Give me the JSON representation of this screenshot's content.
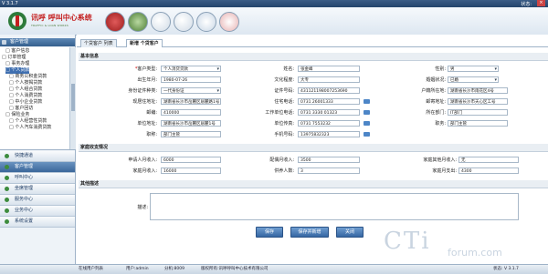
{
  "titlebar": {
    "version": "V 3.1.7",
    "status_label": "状态:",
    "close": "×"
  },
  "header": {
    "brand": "讯呼 呼叫中心系统",
    "brand_en": "TRAFFIC & LOAN WORKS"
  },
  "sidebar": {
    "head1": "客户管理",
    "tree": [
      "□ 客户信息",
      "□ 订单管理",
      "□ 事务办理",
      "□ 个人贷款",
      "□ 商务公积金贷款",
      "□ 个人按揭贷款",
      "□ 个人组合贷款",
      "□ 个人消费贷款",
      "□ 中小企业贷款",
      "□ 客户回访",
      "□ 保险业务",
      "□ 个人经营性贷款",
      "□ 个人汽车消费贷款"
    ],
    "nav": [
      "快捷通道",
      "客户管理",
      "呼叫中心",
      "坐席管理",
      "服务中心",
      "业务中心",
      "系统设置"
    ]
  },
  "tabs": [
    "个贷客户 列表",
    "新增 个贷客户"
  ],
  "section_basic": "基本信息",
  "fields": {
    "customer_type": {
      "label": "客户类型:",
      "value": "个人消贷贷款"
    },
    "name": {
      "label": "姓名:",
      "value": "张金峰"
    },
    "gender": {
      "label": "性别:",
      "value": "男"
    },
    "birthdate": {
      "label": "出生年月:",
      "value": "1980-07-26"
    },
    "education": {
      "label": "文化程度:",
      "value": "大专"
    },
    "marital": {
      "label": "婚姻状况:",
      "value": "已婚"
    },
    "id_type": {
      "label": "身份证件种类:",
      "value": "一代身份证"
    },
    "id_number": {
      "label": "证件号码:",
      "value": "431121198007253690"
    },
    "hukou": {
      "label": "户籍所在地:",
      "value": "湖南省长沙市雨花区4号"
    },
    "address": {
      "label": "现居住地址:",
      "value": "湖南省长沙市岳麓区居麓路1号"
    },
    "home_phone": {
      "label": "住宅电话:",
      "value": "0731 26001333"
    },
    "mail_addr": {
      "label": "邮寄地址:",
      "value": "湖南省长沙市天心区工号"
    },
    "postcode": {
      "label": "邮编:",
      "value": "410000"
    },
    "work_phone": {
      "label": "工作单位电话:",
      "value": "0731 3330 01323"
    },
    "company_addr": {
      "label": "所在部门:",
      "value": "IT部门"
    },
    "company": {
      "label": "单位地址:",
      "value": "湖南省长沙市岳麓区居麓1号"
    },
    "fax": {
      "label": "单位传真:",
      "value": "0731 7553232"
    },
    "title": {
      "label": "职务:",
      "value": "部门主管"
    },
    "position": {
      "label": "职称:",
      "value": "部门主管"
    },
    "mobile": {
      "label": "手机号码:",
      "value": "13975832323"
    }
  },
  "section_family": "家庭收支情况",
  "family": {
    "applicant_income": {
      "label": "申请人月收入:",
      "value": "6000"
    },
    "spouse_income": {
      "label": "配偶月收入:",
      "value": "3500"
    },
    "other_income": {
      "label": "家庭其他月收入:",
      "value": "无"
    },
    "family_total": {
      "label": "家庭月收入:",
      "value": "16000"
    },
    "dependents": {
      "label": "供养人数:",
      "value": "3"
    },
    "monthly_expense": {
      "label": "家庭月支出:",
      "value": "4300"
    }
  },
  "section_other": "其他描述",
  "desc_label": "描述:",
  "buttons": {
    "save": "保存",
    "save_new": "保存并新增",
    "close": "关闭"
  },
  "status": {
    "a": "在线用户列表",
    "b": "用户:admin",
    "c": "分机:8009",
    "d": "版权所有:讯呼呼叫中心技术有限公司",
    "e": "状态: V 3.1.7"
  },
  "watermark": {
    "a": "CTi",
    "b": "forum.com"
  }
}
